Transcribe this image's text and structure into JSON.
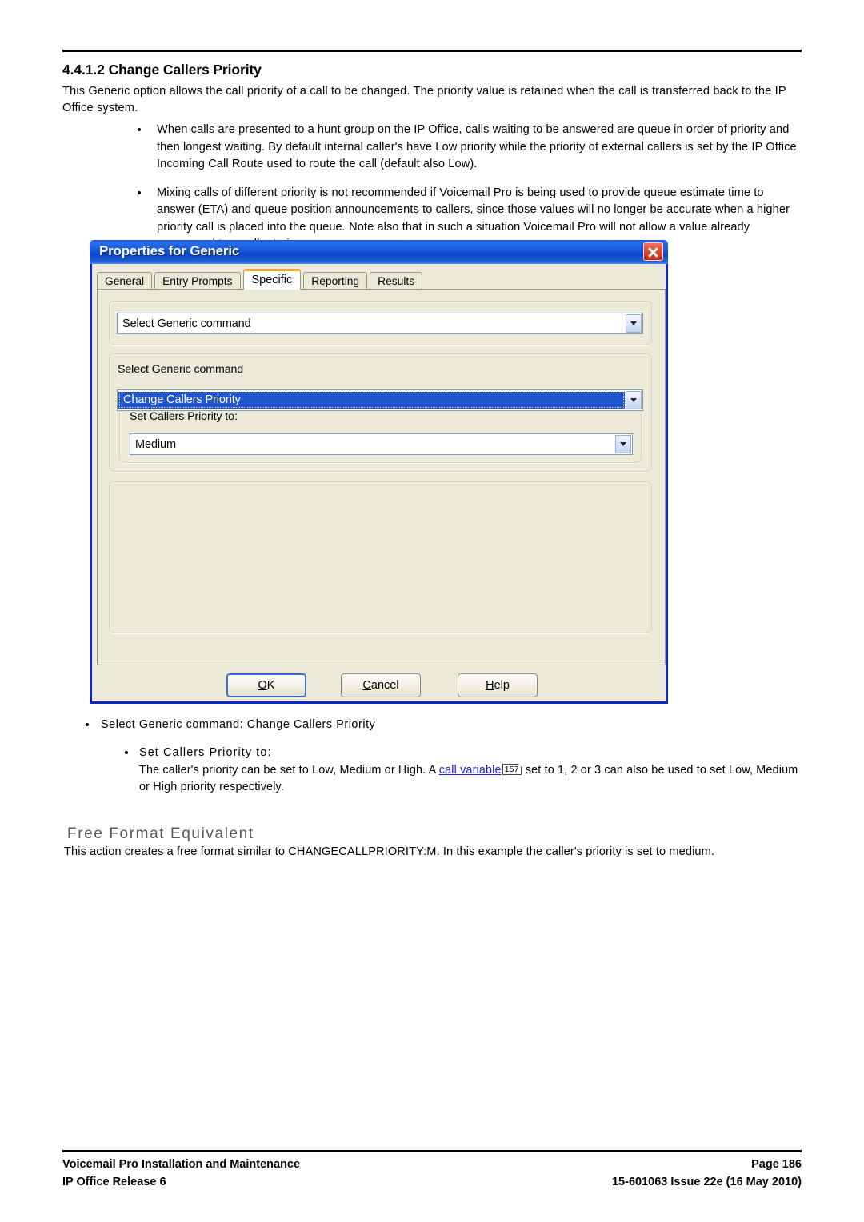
{
  "document": {
    "section_number_title": "4.4.1.2 Change Callers Priority",
    "intro": "This Generic option allows the call priority of a call to be changed. The priority value is retained when the call is transferred back to the IP Office system.",
    "bullets": [
      "When calls are presented to a hunt group on the IP Office, calls waiting to be answered are queue in order of priority and then longest waiting. By default internal caller's have Low priority while the priority of external callers is set by the IP Office Incoming Call Route used to route the call (default also Low).",
      "Mixing calls of different priority is not recommended if Voicemail Pro is being used to provide queue estimate time to answer (ETA) and queue position announcements to callers, since those values will no longer be accurate when a higher priority call is placed into the queue. Note also that in such a situation Voicemail Pro will not allow a value already announced to a caller to increase."
    ]
  },
  "dialog": {
    "title": "Properties for Generic",
    "close_label": "×",
    "tabs": [
      {
        "label": "General",
        "active": false
      },
      {
        "label": "Entry Prompts",
        "active": false
      },
      {
        "label": "Specific",
        "active": true
      },
      {
        "label": "Reporting",
        "active": false
      },
      {
        "label": "Results",
        "active": false
      }
    ],
    "command_combo_top": "Select Generic command",
    "command_group_label": "Select Generic command",
    "command_combo_value": "Change Callers Priority",
    "priority_label": "Set Callers Priority to:",
    "priority_combo_value": "Medium",
    "buttons": {
      "ok_accel": "O",
      "ok_rest": "K",
      "cancel_accel": "C",
      "cancel_rest": "ancel",
      "help_accel": "H",
      "help_rest": "elp"
    },
    "accent_active_tab": "#f0a830",
    "accent_selection": "#2056d0",
    "face_color": "#ece9d8"
  },
  "notes": {
    "level1": "Select Generic command: Change Callers Priority",
    "level2_heading": "Set Callers Priority to:",
    "level2_part1": "The caller's priority can be set to Low, Medium or High. A ",
    "level2_link": "call variable",
    "level2_pageref": "157",
    "level2_part2": " set to 1, 2 or 3 can also be used to set Low, Medium or High priority respectively."
  },
  "free_format": {
    "title": "Free Format Equivalent",
    "body": "This action creates a free format similar to CHANGECALLPRIORITY:M. In this example the caller's priority is set to medium."
  },
  "footer": {
    "left_line1": "Voicemail Pro Installation and Maintenance",
    "left_line2": "IP Office Release 6",
    "right_line1": "Page 186",
    "right_line2": "15-601063 Issue 22e (16 May 2010)"
  }
}
